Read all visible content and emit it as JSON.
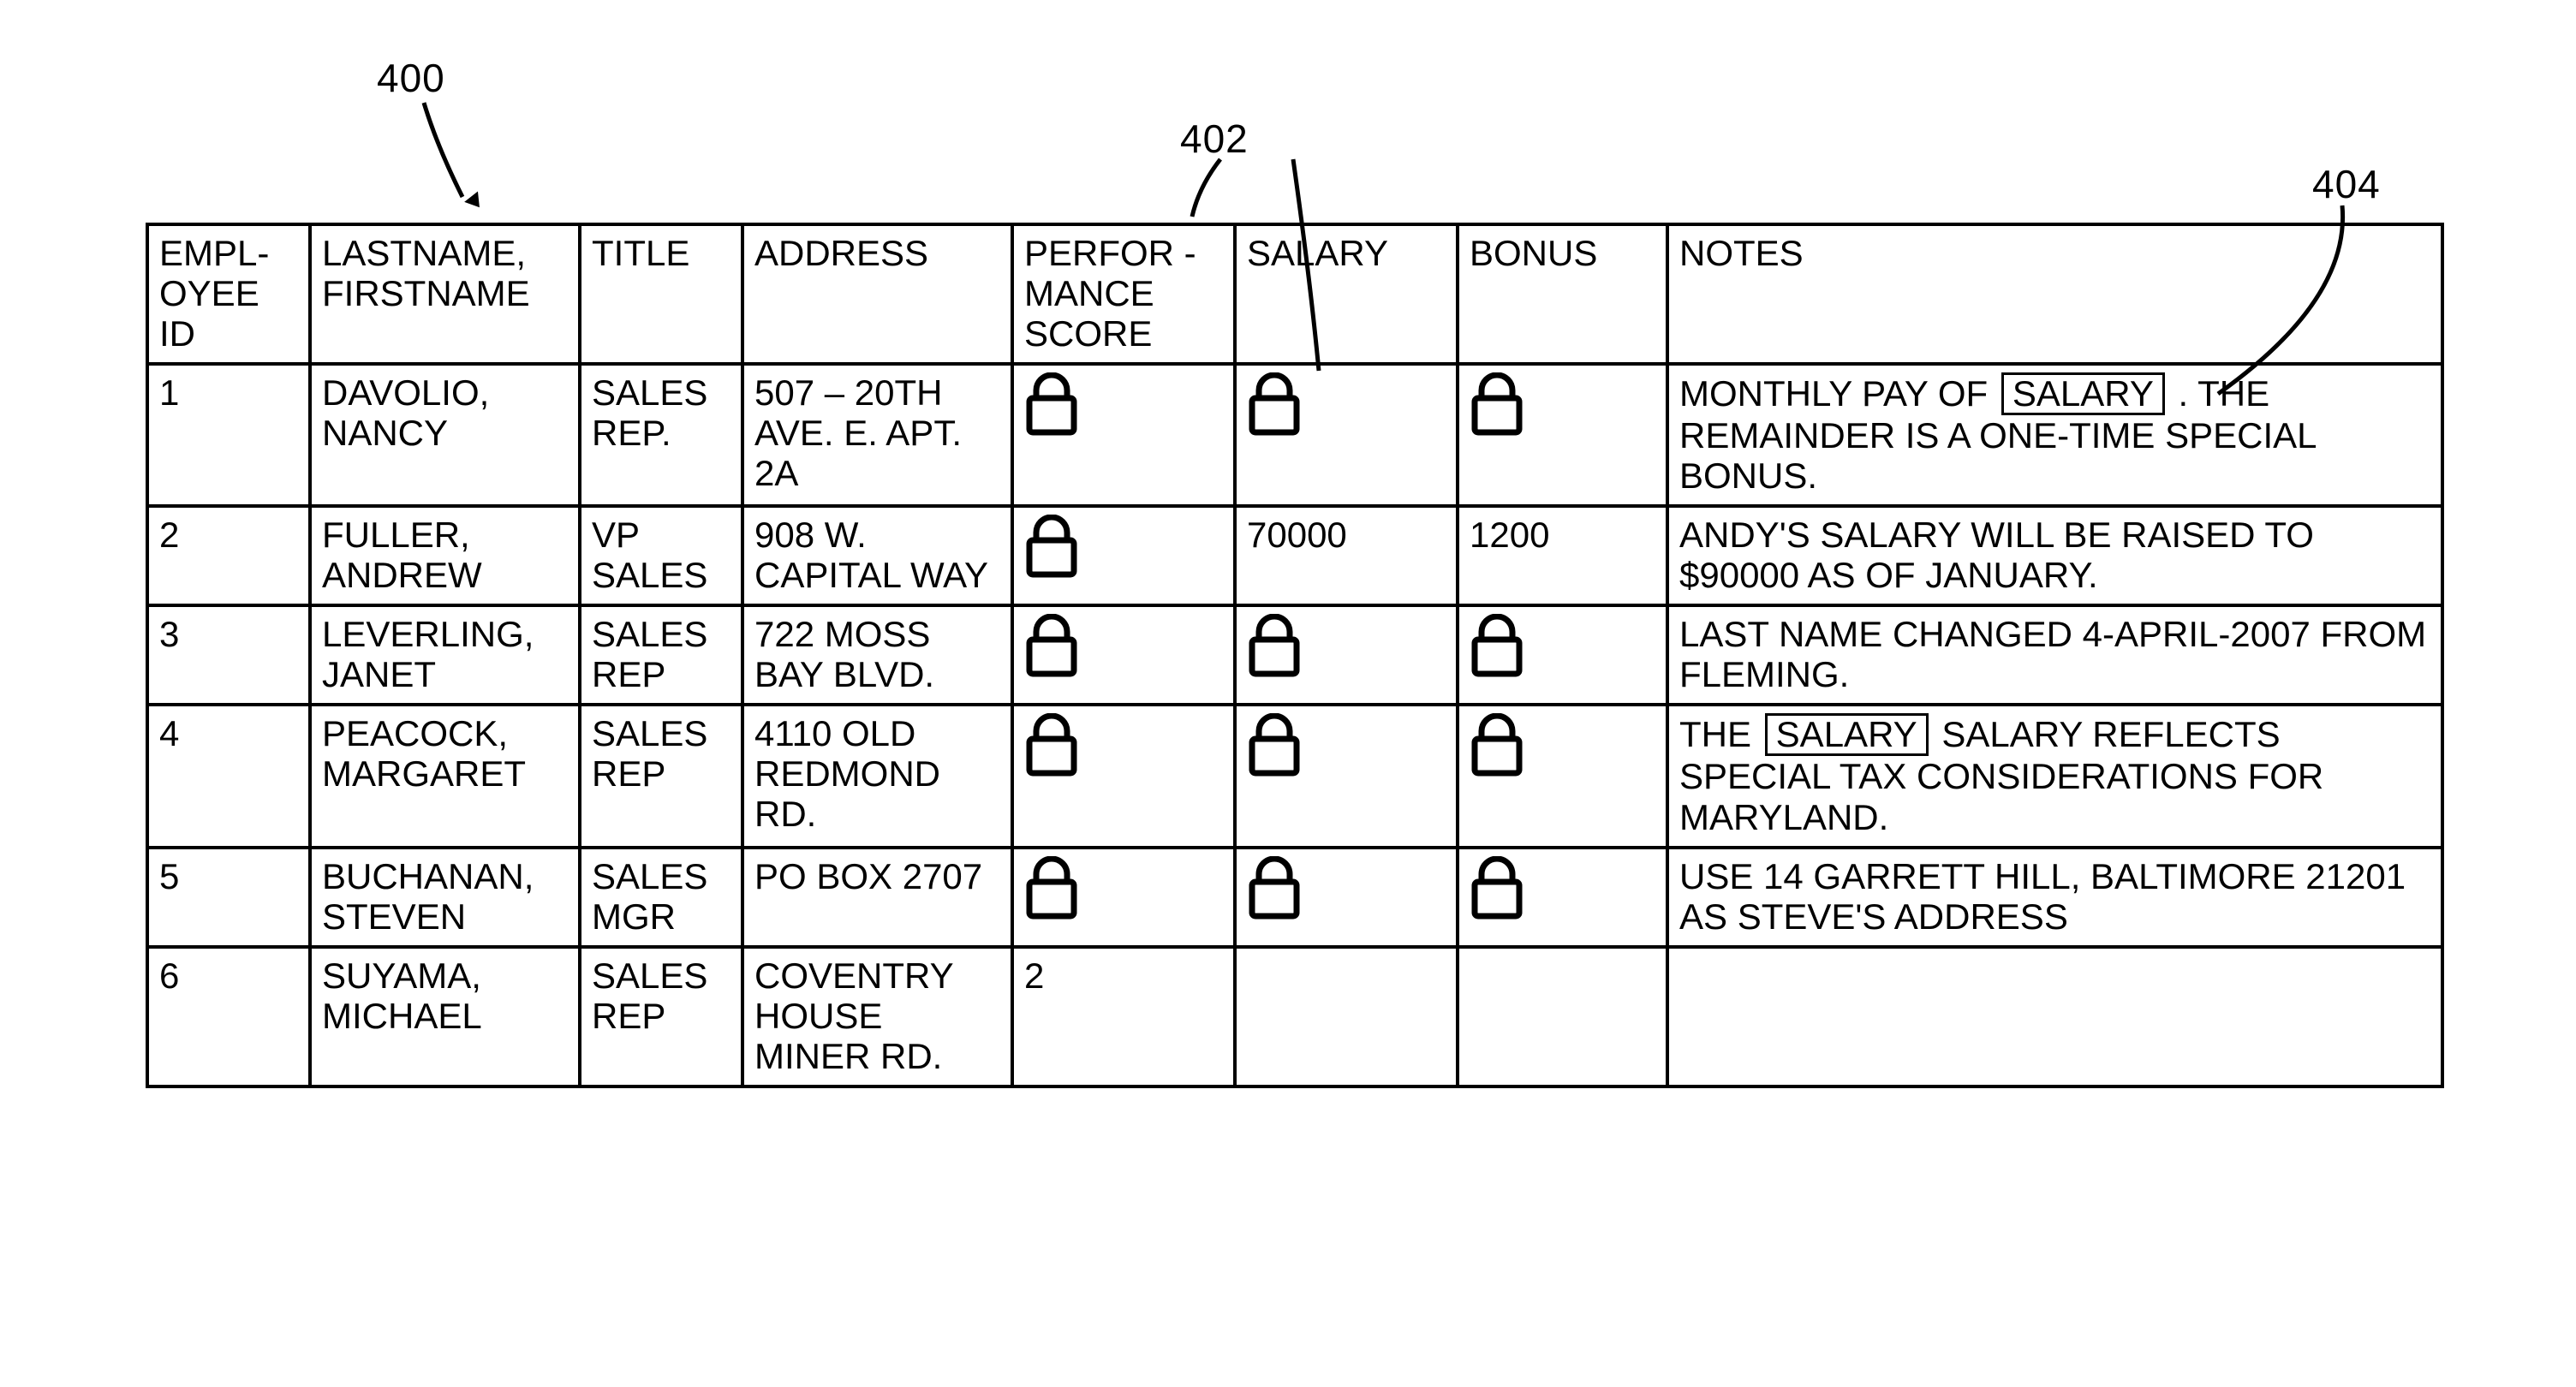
{
  "refs": {
    "r400": "400",
    "r402": "402",
    "r404": "404"
  },
  "table": {
    "headers": {
      "id": "EMPL-OYEE ID",
      "name": "LASTNAME, FIRSTNAME",
      "title": "TITLE",
      "addr": "ADDRESS",
      "perf": "PERFOR -MANCE SCORE",
      "salary": "SALARY",
      "bonus": "BONUS",
      "notes": "NOTES"
    },
    "rows": [
      {
        "id": "1",
        "name": "DAVOLIO, NANCY",
        "title": "SALES REP.",
        "addr": "507 – 20TH AVE. E. APT. 2A",
        "perf": {
          "locked": true,
          "value": ""
        },
        "salary": {
          "locked": true,
          "value": ""
        },
        "bonus": {
          "locked": true,
          "value": ""
        },
        "notes": [
          {
            "t": "text",
            "v": "MONTHLY PAY OF "
          },
          {
            "t": "token",
            "v": "SALARY"
          },
          {
            "t": "text",
            "v": " . THE REMAINDER IS A ONE-TIME SPECIAL BONUS."
          }
        ]
      },
      {
        "id": "2",
        "name": "FULLER, ANDREW",
        "title": "VP SALES",
        "addr": "908 W. CAPITAL WAY",
        "perf": {
          "locked": true,
          "value": ""
        },
        "salary": {
          "locked": false,
          "value": "70000"
        },
        "bonus": {
          "locked": false,
          "value": "1200"
        },
        "notes": [
          {
            "t": "text",
            "v": "ANDY'S SALARY WILL BE RAISED TO $90000 AS OF JANUARY."
          }
        ]
      },
      {
        "id": "3",
        "name": "LEVERLING, JANET",
        "title": "SALES REP",
        "addr": "722 MOSS BAY BLVD.",
        "perf": {
          "locked": true,
          "value": ""
        },
        "salary": {
          "locked": true,
          "value": ""
        },
        "bonus": {
          "locked": true,
          "value": ""
        },
        "notes": [
          {
            "t": "text",
            "v": "LAST NAME CHANGED 4-APRIL-2007 FROM FLEMING."
          }
        ]
      },
      {
        "id": "4",
        "name": "PEACOCK, MARGARET",
        "title": "SALES REP",
        "addr": "4110 OLD REDMOND RD.",
        "perf": {
          "locked": true,
          "value": ""
        },
        "salary": {
          "locked": true,
          "value": ""
        },
        "bonus": {
          "locked": true,
          "value": ""
        },
        "notes": [
          {
            "t": "text",
            "v": "THE "
          },
          {
            "t": "token",
            "v": "SALARY"
          },
          {
            "t": "text",
            "v": " SALARY REFLECTS SPECIAL TAX CONSIDERATIONS FOR MARYLAND."
          }
        ]
      },
      {
        "id": "5",
        "name": "BUCHANAN, STEVEN",
        "title": "SALES MGR",
        "addr": "PO BOX 2707",
        "perf": {
          "locked": true,
          "value": ""
        },
        "salary": {
          "locked": true,
          "value": ""
        },
        "bonus": {
          "locked": true,
          "value": ""
        },
        "notes": [
          {
            "t": "text",
            "v": "USE 14 GARRETT HILL, BALTIMORE 21201 AS STEVE'S ADDRESS"
          }
        ]
      },
      {
        "id": "6",
        "name": "SUYAMA, MICHAEL",
        "title": "SALES REP",
        "addr": "COVENTRY HOUSE MINER RD.",
        "perf": {
          "locked": false,
          "value": "2"
        },
        "salary": {
          "locked": false,
          "value": ""
        },
        "bonus": {
          "locked": false,
          "value": ""
        },
        "notes": []
      }
    ]
  }
}
